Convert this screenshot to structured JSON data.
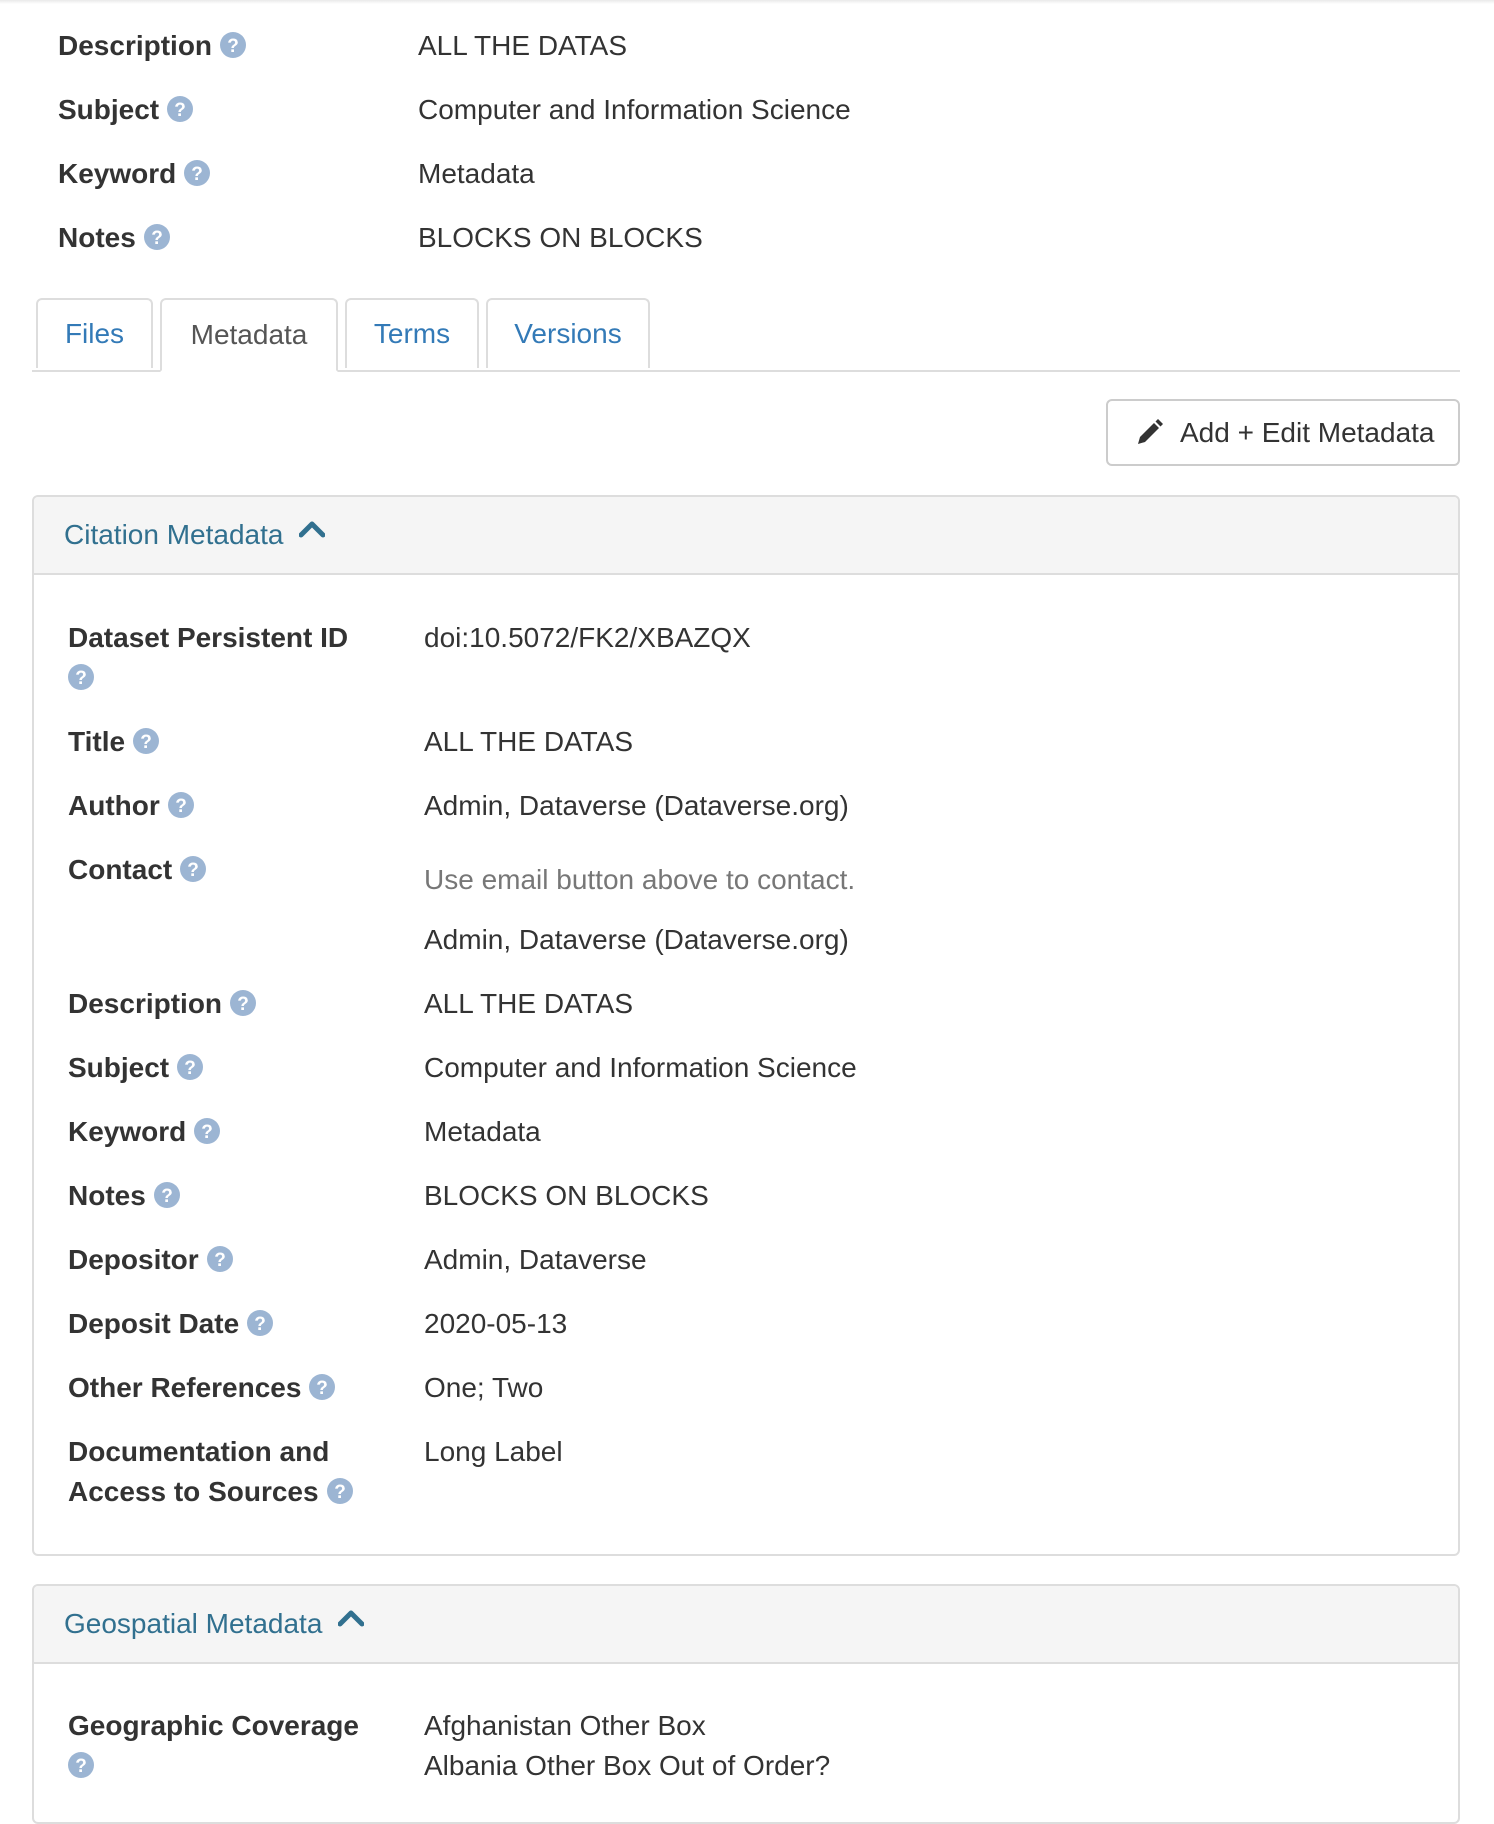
{
  "summary": [
    {
      "label": "Description",
      "value": "ALL THE DATAS"
    },
    {
      "label": "Subject",
      "value": "Computer and Information Science"
    },
    {
      "label": "Keyword",
      "value": "Metadata"
    },
    {
      "label": "Notes",
      "value": "BLOCKS ON BLOCKS"
    }
  ],
  "tabs": [
    {
      "label": "Files",
      "active": false
    },
    {
      "label": "Metadata",
      "active": true
    },
    {
      "label": "Terms",
      "active": false
    },
    {
      "label": "Versions",
      "active": false
    }
  ],
  "edit_button": {
    "label": "Add + Edit Metadata",
    "icon": "pencil-icon"
  },
  "citation": {
    "title": "Citation Metadata",
    "rows": [
      {
        "label": "Dataset Persistent ID",
        "value": "doi:10.5072/FK2/XBAZQX"
      },
      {
        "label": "Title",
        "value": "ALL THE DATAS"
      },
      {
        "label": "Author",
        "value": "Admin, Dataverse (Dataverse.org)"
      },
      {
        "label": "Contact",
        "note": "Use email button above to contact.",
        "value": "Admin, Dataverse (Dataverse.org)"
      },
      {
        "label": "Description",
        "value": "ALL THE DATAS"
      },
      {
        "label": "Subject",
        "value": "Computer and Information Science"
      },
      {
        "label": "Keyword",
        "value": "Metadata"
      },
      {
        "label": "Notes",
        "value": "BLOCKS ON BLOCKS"
      },
      {
        "label": "Depositor",
        "value": "Admin, Dataverse"
      },
      {
        "label": "Deposit Date",
        "value": "2020-05-13"
      },
      {
        "label": "Other References",
        "value": "One; Two"
      },
      {
        "label": "Documentation and Access to Sources",
        "label_line1": "Documentation and",
        "label_line2": "Access to Sources",
        "value": "Long Label"
      }
    ]
  },
  "geospatial": {
    "title": "Geospatial Metadata",
    "rows": [
      {
        "label": "Geographic Coverage",
        "value_line1": "Afghanistan Other Box",
        "value_line2": "Albania Other Box Out of Order?"
      }
    ]
  },
  "colors": {
    "link": "#337ab7",
    "panel_title": "#31708f",
    "help_icon": "#9cb5d3"
  }
}
